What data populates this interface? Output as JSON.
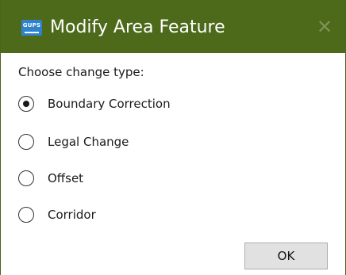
{
  "window": {
    "title": "Modify Area Feature",
    "app_icon_text": "GUPS",
    "close_symbol": "✕",
    "titlebar_color": "#4d6a1b"
  },
  "dialog": {
    "prompt": "Choose change type:",
    "options": [
      {
        "label": "Boundary Correction",
        "selected": true
      },
      {
        "label": "Legal Change",
        "selected": false
      },
      {
        "label": "Offset",
        "selected": false
      },
      {
        "label": "Corridor",
        "selected": false
      }
    ],
    "ok_label": "OK"
  },
  "icons": {
    "app": "gups-app-icon",
    "close": "close-icon"
  }
}
